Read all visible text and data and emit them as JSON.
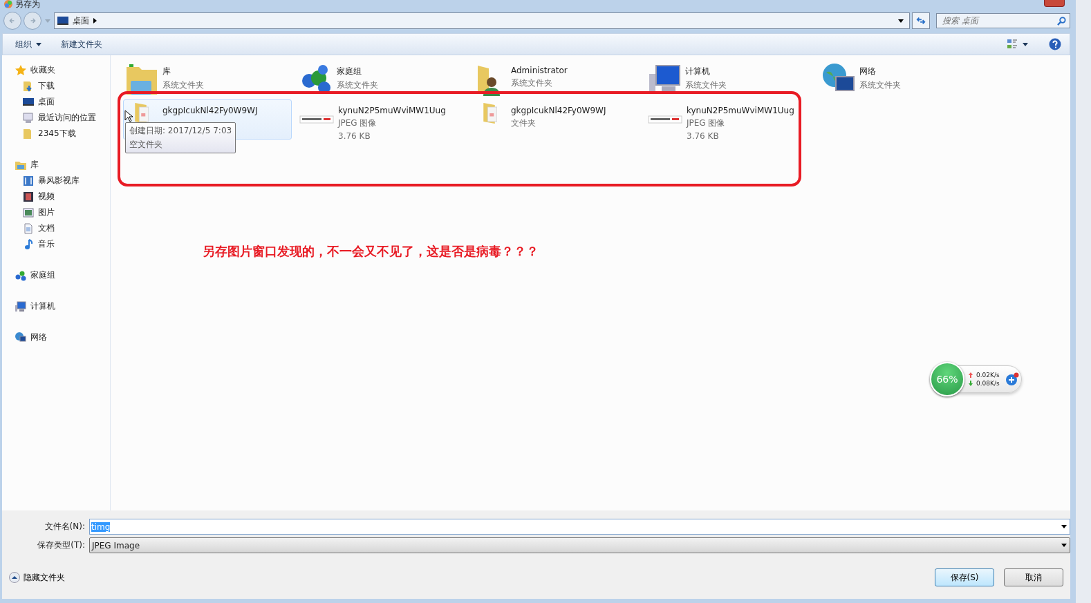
{
  "window": {
    "title": "另存为"
  },
  "address": {
    "crumbs": [
      "桌面"
    ]
  },
  "search": {
    "placeholder": "搜索 桌面"
  },
  "toolbar": {
    "buttons": [
      {
        "label": "组织",
        "dropdown": true
      },
      {
        "label": "新建文件夹",
        "dropdown": false
      }
    ]
  },
  "sidebar": {
    "groups": [
      {
        "label": "收藏夹",
        "kind": "star",
        "children": [
          {
            "label": "下载",
            "kind": "download"
          },
          {
            "label": "桌面",
            "kind": "desktop"
          },
          {
            "label": "最近访问的位置",
            "kind": "recent"
          },
          {
            "label": "2345下载",
            "kind": "folder"
          }
        ]
      },
      {
        "label": "库",
        "kind": "library",
        "children": [
          {
            "label": "暴风影视库",
            "kind": "video"
          },
          {
            "label": "视频",
            "kind": "film"
          },
          {
            "label": "图片",
            "kind": "picture"
          },
          {
            "label": "文档",
            "kind": "doc"
          },
          {
            "label": "音乐",
            "kind": "music"
          }
        ]
      },
      {
        "label": "家庭组",
        "kind": "homegroup"
      },
      {
        "label": "计算机",
        "kind": "computer"
      },
      {
        "label": "网络",
        "kind": "network"
      }
    ]
  },
  "items": [
    {
      "name": "库",
      "type": "系统文件夹",
      "kind": "library",
      "selected": false
    },
    {
      "name": "家庭组",
      "type": "系统文件夹",
      "kind": "homegroup",
      "selected": false
    },
    {
      "name": "Administrator",
      "type": "系统文件夹",
      "kind": "user",
      "selected": false
    },
    {
      "name": "计算机",
      "type": "系统文件夹",
      "kind": "computer",
      "selected": false
    },
    {
      "name": "网络",
      "type": "系统文件夹",
      "kind": "network",
      "selected": false
    },
    {
      "name": "gkgpIcukNl42Fy0W9WJ",
      "kind": "folder",
      "selected": true
    },
    {
      "name": "kynuN2P5muWviMW1Uug",
      "type": "JPEG 图像",
      "size": "3.76 KB",
      "selected": false
    },
    {
      "name": "gkgpIcukNl42Fy0W9WJ",
      "type": "文件夹",
      "kind": "folder",
      "selected": false
    },
    {
      "name": "kynuN2P5muWviMW1Uug",
      "type": "JPEG 图像",
      "size": "3.76 KB",
      "selected": false
    }
  ],
  "tooltip": {
    "lines": [
      "创建日期: 2017/12/5 7:03",
      "空文件夹"
    ]
  },
  "annotation": {
    "text": "另存图片窗口发现的，不一会又不见了，这是否是病毒？？？"
  },
  "net_widget": {
    "percent": "66%",
    "up": "0.02K/s",
    "down": "0.08K/s"
  },
  "form": {
    "filename_label": "文件名(N):",
    "filename": "timg",
    "type_label": "保存类型(T):",
    "type": "JPEG Image"
  },
  "hide_folders": "隐藏文件夹",
  "buttons": [
    {
      "label": "保存(S)",
      "default": true
    },
    {
      "label": "取消",
      "default": false
    }
  ]
}
